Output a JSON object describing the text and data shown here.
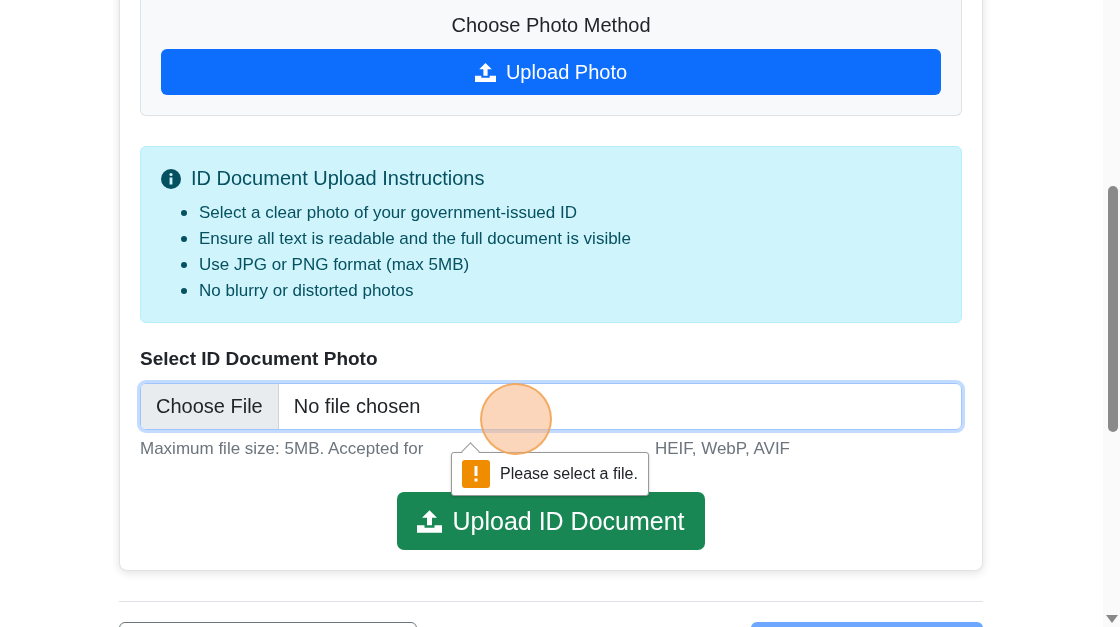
{
  "method_panel": {
    "title": "Choose Photo Method",
    "upload_button": "Upload Photo"
  },
  "instructions": {
    "title": "ID Document Upload Instructions",
    "items": [
      "Select a clear photo of your government-issued ID",
      "Ensure all text is readable and the full document is visible",
      "Use JPG or PNG format (max 5MB)",
      "No blurry or distorted photos"
    ]
  },
  "file_field": {
    "label": "Select ID Document Photo",
    "button": "Choose File",
    "value": "No file chosen",
    "hint_start": "Maximum file size: 5MB. Accepted for",
    "hint_end": "HEIF, WebP, AVIF"
  },
  "validation_tooltip": {
    "message": "Please select a file."
  },
  "submit_button": "Upload ID Document"
}
